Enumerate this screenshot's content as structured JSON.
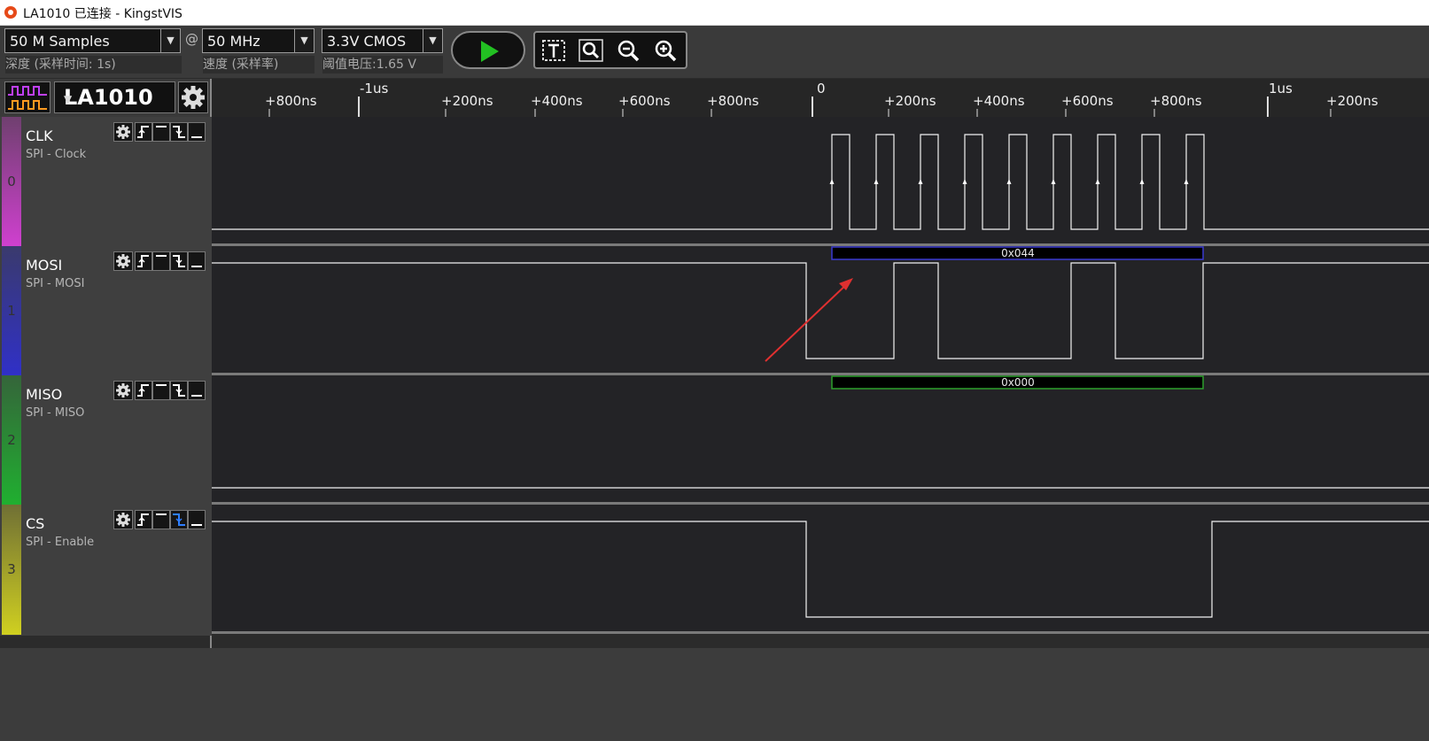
{
  "window": {
    "title": "LA1010 已连接 - KingstVIS"
  },
  "toolbar": {
    "depth": {
      "value": "50 M Samples",
      "label": "深度 (采样时间: 1s)"
    },
    "at_symbol": "@",
    "rate": {
      "value": "50 MHz",
      "label": "速度 (采样率)"
    },
    "threshold": {
      "value": "3.3V CMOS",
      "label": "阈值电压:1.65 V"
    },
    "run_button": "start",
    "tools": [
      "text-cursor-icon",
      "zoom-fit-icon",
      "zoom-out-icon",
      "zoom-in-icon"
    ]
  },
  "device": {
    "name": "LA1010"
  },
  "ruler": {
    "ticks": [
      "+800ns",
      "-1us",
      "+200ns",
      "+400ns",
      "+600ns",
      "+800ns",
      "0",
      "+200ns",
      "+400ns",
      "+600ns",
      "+800ns",
      "1us",
      "+200ns"
    ]
  },
  "channels": [
    {
      "index": "0",
      "name": "CLK",
      "desc": "SPI - Clock",
      "color": "#d040d0"
    },
    {
      "index": "1",
      "name": "MOSI",
      "desc": "SPI - MOSI",
      "color": "#3030c8"
    },
    {
      "index": "2",
      "name": "MISO",
      "desc": "SPI - MISO",
      "color": "#20b030"
    },
    {
      "index": "3",
      "name": "CS",
      "desc": "SPI - Enable",
      "color": "#d0d020"
    }
  ],
  "decoded": {
    "mosi": "0x044",
    "miso": "0x000"
  },
  "colors": {
    "mosi_frame": "#3a3ad0",
    "miso_frame": "#2ca02c",
    "annotation_arrow": "#e03030",
    "cs_trigger_active": "#2f7fff"
  }
}
